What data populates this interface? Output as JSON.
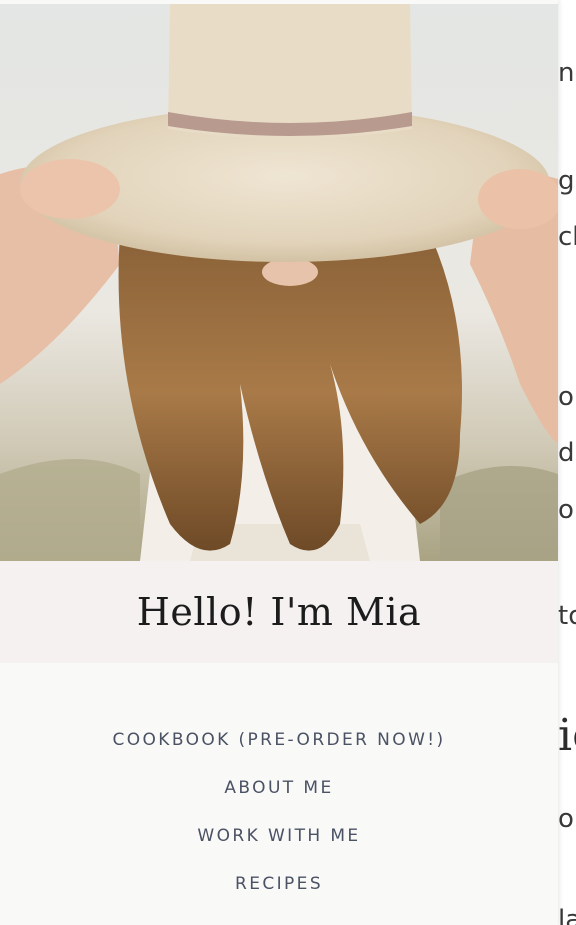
{
  "background_page": {
    "fragments": [
      "nc",
      "g",
      "ch",
      "o",
      "d",
      "or",
      "to",
      "ic",
      "or",
      "la"
    ]
  },
  "sidebar": {
    "hero_image": "woman-with-straw-hat-photo",
    "title": "Hello! I'm Mia",
    "menu": [
      {
        "label": "COOKBOOK (PRE-ORDER NOW!)"
      },
      {
        "label": "ABOUT ME"
      },
      {
        "label": "WORK WITH ME"
      },
      {
        "label": "RECIPES"
      }
    ]
  },
  "colors": {
    "title_band": "#f4f1f0",
    "panel": "#f9f9f8",
    "menu_text": "#4a5263"
  }
}
